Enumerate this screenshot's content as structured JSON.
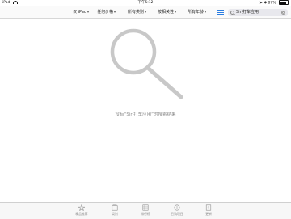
{
  "status_bar": {
    "device": "iPad",
    "time": "下午5:12",
    "battery": "87%",
    "battery_level": 0.87
  },
  "filters": [
    {
      "label": "仅 iPad"
    },
    {
      "label": "任何价格"
    },
    {
      "label": "所有类别"
    },
    {
      "label": "按相关性"
    },
    {
      "label": "所有年龄"
    }
  ],
  "search": {
    "value": "Siri打车应用"
  },
  "empty_state": {
    "message": "没有“Siri打车应用”的搜索结果"
  },
  "tab_bar": {
    "tabs": [
      {
        "label": "精品推荐",
        "icon": "star-icon"
      },
      {
        "label": "类别",
        "icon": "categories-icon"
      },
      {
        "label": "排行榜",
        "icon": "top-charts-icon"
      },
      {
        "label": "已购项目",
        "icon": "purchased-icon"
      },
      {
        "label": "更新",
        "icon": "updates-icon"
      }
    ]
  }
}
